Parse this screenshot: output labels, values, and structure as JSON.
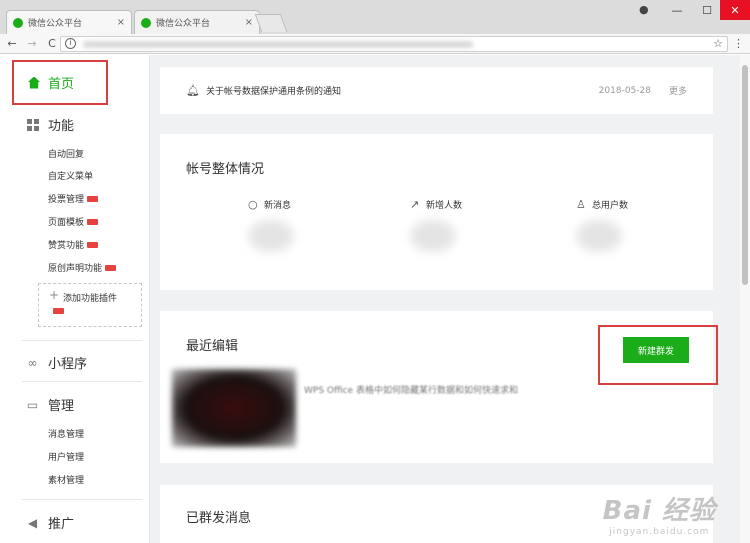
{
  "browser": {
    "tabs": [
      {
        "title": "微信公众平台",
        "close": "×"
      },
      {
        "title": "微信公众平台",
        "close": "×"
      }
    ],
    "window_buttons": {
      "minimize": "—",
      "maximize": "☐",
      "close": "✕"
    },
    "profile_icon": "●",
    "nav": {
      "back": "←",
      "forward": "→",
      "reload": "C"
    },
    "info_icon": "i",
    "star_icon": "☆",
    "menu_icon": "⋮"
  },
  "sidebar": {
    "home": "首页",
    "function": {
      "label": "功能",
      "items": [
        "自动回复",
        "自定义菜单",
        "投票管理",
        "页面模板",
        "赞赏功能",
        "原创声明功能"
      ],
      "add_plugin": "添加功能插件"
    },
    "miniprogram": {
      "label": "小程序",
      "icon": "∞"
    },
    "manage": {
      "label": "管理",
      "icon": "▭",
      "items": [
        "消息管理",
        "用户管理",
        "素材管理"
      ]
    },
    "promote": {
      "label": "推广",
      "icon": "◀"
    }
  },
  "notice": {
    "text": "关于帐号数据保护通用条例的通知",
    "date": "2018-05-28",
    "more": "更多"
  },
  "overview": {
    "title": "帐号整体情况",
    "stats": [
      {
        "label": "新消息",
        "icon": "○"
      },
      {
        "label": "新增人数",
        "icon": "↗"
      },
      {
        "label": "总用户数",
        "icon": "♙"
      }
    ]
  },
  "recent": {
    "title": "最近编辑",
    "new_button": "新建群发",
    "article_title": "WPS Office 表格中如何隐藏某行数据和如何快速求和"
  },
  "sent": {
    "title": "已群发消息"
  },
  "watermark": {
    "main": "Bai 经验",
    "sub": "jingyan.baidu.com"
  },
  "colors": {
    "brand_green": "#1aad19",
    "highlight_red": "#d64040",
    "badge_red": "#e64340"
  }
}
